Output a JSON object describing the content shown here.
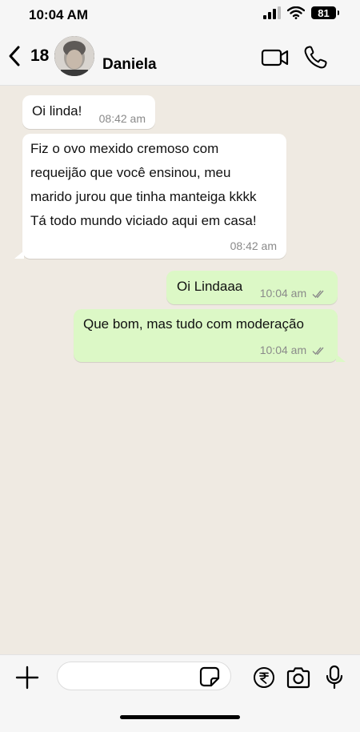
{
  "status_bar": {
    "time": "10:04 AM",
    "battery": "81"
  },
  "header": {
    "unread_count": "18",
    "contact_name": "Daniela"
  },
  "messages": [
    {
      "direction": "incoming",
      "text": "Oi linda!",
      "time": "08:42 am"
    },
    {
      "direction": "incoming",
      "text": "Fiz o ovo mexido cremoso com\nrequeijão que você ensinou, meu\nmarido jurou que tinha manteiga kkkk\nTá todo mundo viciado aqui em casa!",
      "time": "08:42 am"
    },
    {
      "direction": "outgoing",
      "text": "Oi Lindaaa",
      "time": "10:04 am",
      "status": "read"
    },
    {
      "direction": "outgoing",
      "text": "Que bom, mas tudo com moderação",
      "time": "10:04 am",
      "status": "read"
    }
  ],
  "composer": {
    "placeholder": ""
  },
  "colors": {
    "chat_background": "#efeae2",
    "outgoing_bubble": "#dcf8c6",
    "incoming_bubble": "#ffffff",
    "tick_color": "#8a8a8a"
  },
  "icons": {
    "back": "chevron-left-icon",
    "video_call": "video-camera-icon",
    "voice_call": "phone-icon",
    "attach": "plus-icon",
    "sticker": "sticker-icon",
    "payment": "rupee-icon",
    "camera": "camera-icon",
    "mic": "microphone-icon",
    "read": "double-check-icon"
  }
}
